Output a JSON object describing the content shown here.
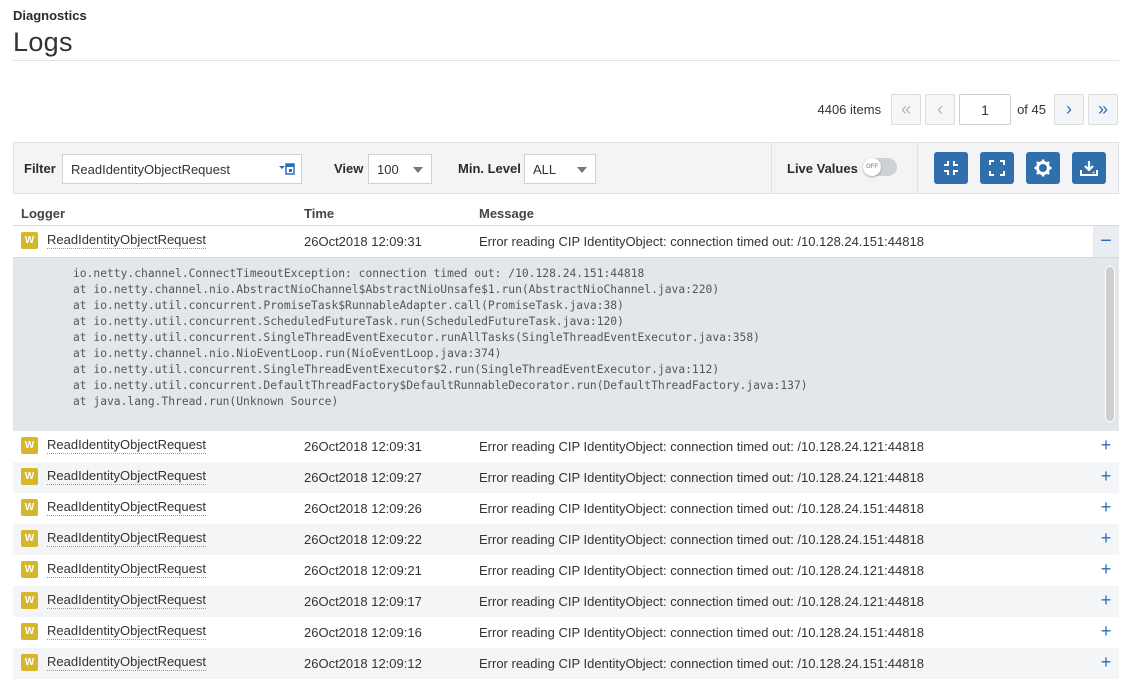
{
  "header": {
    "breadcrumb": "Diagnostics",
    "title": "Logs"
  },
  "pager": {
    "items_count": "4406 items",
    "first_label": "«",
    "prev_label": "‹",
    "current_page": "1",
    "of_label": "of 45",
    "next_label": "›",
    "last_label": "»"
  },
  "toolbar": {
    "filter_label": "Filter",
    "filter_value": "ReadIdentityObjectRequest",
    "view_label": "View",
    "view_value": "100",
    "min_level_label": "Min. Level",
    "min_level_value": "ALL",
    "live_values_label": "Live Values",
    "toggle_text": "OFF",
    "buttons": [
      "compress-icon",
      "fullscreen-icon",
      "gear-icon",
      "download-icon"
    ],
    "accent_color": "#2f6fab"
  },
  "table": {
    "headers": {
      "logger": "Logger",
      "time": "Time",
      "message": "Message"
    },
    "level_badge": "W",
    "level_color": "#d4b72a",
    "rows": [
      {
        "logger": "ReadIdentityObjectRequest",
        "time": "26Oct2018 12:09:31",
        "message": "Error reading CIP IdentityObject: connection timed out: /10.128.24.151:44818",
        "expander": "−"
      },
      {
        "logger": "ReadIdentityObjectRequest",
        "time": "26Oct2018 12:09:31",
        "message": "Error reading CIP IdentityObject: connection timed out: /10.128.24.121:44818",
        "expander": "+"
      },
      {
        "logger": "ReadIdentityObjectRequest",
        "time": "26Oct2018 12:09:27",
        "message": "Error reading CIP IdentityObject: connection timed out: /10.128.24.121:44818",
        "expander": "+"
      },
      {
        "logger": "ReadIdentityObjectRequest",
        "time": "26Oct2018 12:09:26",
        "message": "Error reading CIP IdentityObject: connection timed out: /10.128.24.151:44818",
        "expander": "+"
      },
      {
        "logger": "ReadIdentityObjectRequest",
        "time": "26Oct2018 12:09:22",
        "message": "Error reading CIP IdentityObject: connection timed out: /10.128.24.151:44818",
        "expander": "+"
      },
      {
        "logger": "ReadIdentityObjectRequest",
        "time": "26Oct2018 12:09:21",
        "message": "Error reading CIP IdentityObject: connection timed out: /10.128.24.121:44818",
        "expander": "+"
      },
      {
        "logger": "ReadIdentityObjectRequest",
        "time": "26Oct2018 12:09:17",
        "message": "Error reading CIP IdentityObject: connection timed out: /10.128.24.121:44818",
        "expander": "+"
      },
      {
        "logger": "ReadIdentityObjectRequest",
        "time": "26Oct2018 12:09:16",
        "message": "Error reading CIP IdentityObject: connection timed out: /10.128.24.151:44818",
        "expander": "+"
      },
      {
        "logger": "ReadIdentityObjectRequest",
        "time": "26Oct2018 12:09:12",
        "message": "Error reading CIP IdentityObject: connection timed out: /10.128.24.151:44818",
        "expander": "+"
      }
    ],
    "stack_trace": [
      "io.netty.channel.ConnectTimeoutException: connection timed out: /10.128.24.151:44818",
      "at io.netty.channel.nio.AbstractNioChannel$AbstractNioUnsafe$1.run(AbstractNioChannel.java:220)",
      "at io.netty.util.concurrent.PromiseTask$RunnableAdapter.call(PromiseTask.java:38)",
      "at io.netty.util.concurrent.ScheduledFutureTask.run(ScheduledFutureTask.java:120)",
      "at io.netty.util.concurrent.SingleThreadEventExecutor.runAllTasks(SingleThreadEventExecutor.java:358)",
      "at io.netty.channel.nio.NioEventLoop.run(NioEventLoop.java:374)",
      "at io.netty.util.concurrent.SingleThreadEventExecutor$2.run(SingleThreadEventExecutor.java:112)",
      "at io.netty.util.concurrent.DefaultThreadFactory$DefaultRunnableDecorator.run(DefaultThreadFactory.java:137)",
      "at java.lang.Thread.run(Unknown Source)"
    ]
  }
}
